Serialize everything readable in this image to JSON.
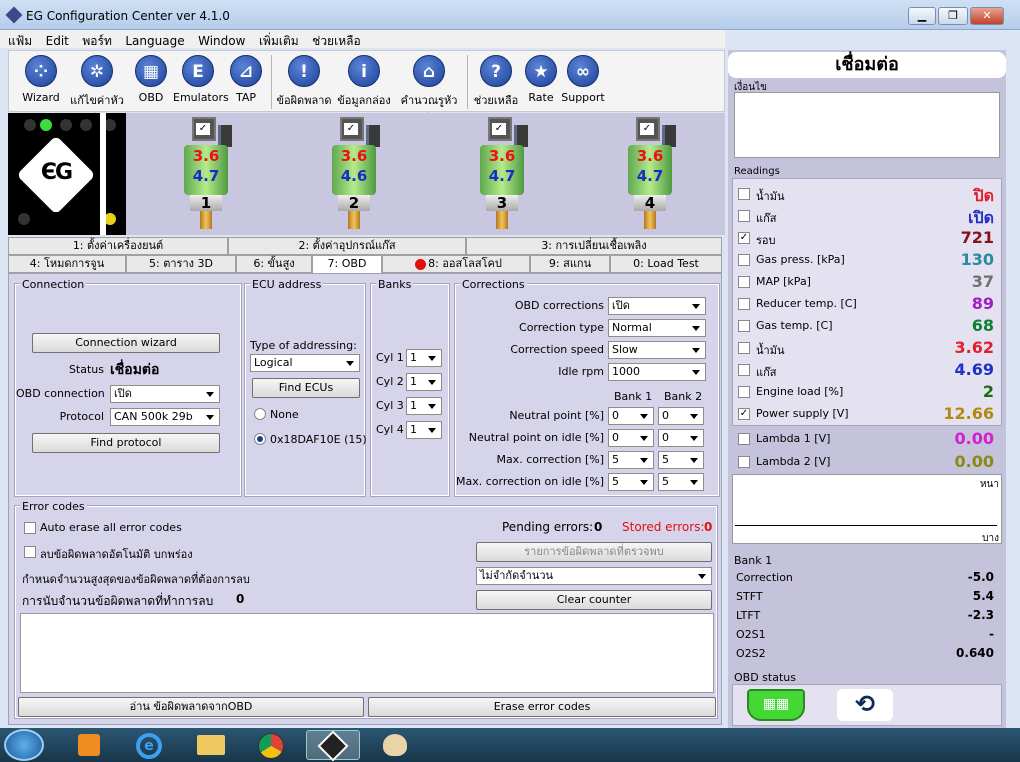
{
  "window": {
    "title": "EG Configuration Center ver 4.1.0"
  },
  "menu": [
    "แฟ้ม",
    "Edit",
    "พอร์ท",
    "Language",
    "Window",
    "เพิ่มเติม",
    "ช่วยเหลือ"
  ],
  "toolbar": [
    {
      "label": "Wizard",
      "icon": "wizard-icon",
      "glyph": "⁘"
    },
    {
      "label": "แก้ไขค่าหัวฉีด",
      "icon": "gear-icon",
      "glyph": "✲"
    },
    {
      "label": "OBD",
      "icon": "obd-icon",
      "glyph": "▦"
    },
    {
      "label": "Emulators",
      "icon": "emulator-icon",
      "glyph": "E"
    },
    {
      "label": "TAP",
      "icon": "tap-icon",
      "glyph": "⊿"
    },
    {
      "label": "ข้อผิดพลาด",
      "icon": "error-icon",
      "glyph": "!"
    },
    {
      "label": "ข้อมูลกล่อง",
      "icon": "info-icon",
      "glyph": "i"
    },
    {
      "label": "คำนวณรูหัวฉีด",
      "icon": "calc-icon",
      "glyph": "⌂"
    },
    {
      "label": "ช่วยเหลือ",
      "icon": "help-icon",
      "glyph": "?"
    },
    {
      "label": "Rate",
      "icon": "star-icon",
      "glyph": "★"
    },
    {
      "label": "Support",
      "icon": "support-icon",
      "glyph": "∞"
    }
  ],
  "injectors": [
    {
      "num": "1",
      "v1": "3.6",
      "v2": "4.7"
    },
    {
      "num": "2",
      "v1": "3.6",
      "v2": "4.6"
    },
    {
      "num": "3",
      "v1": "3.6",
      "v2": "4.7"
    },
    {
      "num": "4",
      "v1": "3.6",
      "v2": "4.7"
    }
  ],
  "tabs_row1": [
    "1: ตั้งค่าเครื่องยนต์",
    "2: ตั้งค่าอุปกรณ์แก๊ส",
    "3: การเปลี่ยนเชื้อเพลิง"
  ],
  "tabs_row2": [
    "4: โหมดการจูน",
    "5: ตาราง 3D",
    "6: ขั้นสูง",
    "7: OBD",
    "8: ออสโลสโคป",
    "9: สแกน",
    "0: Load Test"
  ],
  "connection": {
    "title": "Connection",
    "wizard_btn": "Connection wizard",
    "status_label": "Status",
    "status_value": "เชื่อมต่อ",
    "obd_label": "OBD connection",
    "obd_value": "เปิด",
    "protocol_label": "Protocol",
    "protocol_value": "CAN 500k 29b",
    "find_btn": "Find protocol"
  },
  "ecu": {
    "title": "ECU address",
    "type_label": "Type of addressing:",
    "type_value": "Logical",
    "find_btn": "Find ECUs",
    "opt_none": "None",
    "opt_addr": "0x18DAF10E (15)"
  },
  "banks": {
    "title": "Banks",
    "cyl": [
      {
        "label": "Cyl 1",
        "value": "1"
      },
      {
        "label": "Cyl 2",
        "value": "1"
      },
      {
        "label": "Cyl 3",
        "value": "1"
      },
      {
        "label": "Cyl 4",
        "value": "1"
      }
    ]
  },
  "corrections": {
    "title": "Corrections",
    "obd_corr_label": "OBD corrections",
    "obd_corr_value": "เปิด",
    "type_label": "Correction type",
    "type_value": "Normal",
    "speed_label": "Correction speed",
    "speed_value": "Slow",
    "idle_label": "Idle rpm",
    "idle_value": "1000",
    "bank1_hdr": "Bank 1",
    "bank2_hdr": "Bank 2",
    "rows": [
      {
        "label": "Neutral point [%]",
        "b1": "0",
        "b2": "0"
      },
      {
        "label": "Neutral point on idle [%]",
        "b1": "0",
        "b2": "0"
      },
      {
        "label": "Max. correction [%]",
        "b1": "5",
        "b2": "5"
      },
      {
        "label": "Max. correction on idle [%]",
        "b1": "5",
        "b2": "5"
      }
    ]
  },
  "errors": {
    "title": "Error codes",
    "auto_erase": "Auto erase all error codes",
    "auto_erase_th": "ลบข้อผิดพลาดอัตโนมัติ บกพร่อง",
    "pending_label": "Pending errors:",
    "pending_value": "0",
    "stored_label": "Stored errors:",
    "stored_value": "0",
    "list_btn": "รายการข้อผิดพลาดที่ตรวจพบ",
    "max_label": "กำหนดจำนวนสูงสุดของข้อผิดพลาดที่ต้องการลบ",
    "max_value": "ไม่จำกัดจำนวน",
    "counter_label": "การนับจำนวนข้อผิดพลาดที่ทำการลบ",
    "counter_value": "0",
    "clear_btn": "Clear counter",
    "read_btn": "อ่าน ข้อผิดพลาดจากOBD",
    "erase_btn": "Erase error codes"
  },
  "right": {
    "status_title": "เชื่อมต่อ",
    "cond_label": "เงื่อนไข",
    "readings_label": "Readings",
    "readings": [
      {
        "name": "น้ำมัน",
        "value": "ปิด",
        "color": "#e0202a",
        "checked": false
      },
      {
        "name": "แก๊ส",
        "value": "เปิด",
        "color": "#2030c8",
        "checked": false
      },
      {
        "name": "รอบ",
        "value": "721",
        "color": "#8a1020",
        "checked": true
      },
      {
        "name": "Gas press. [kPa]",
        "value": "130",
        "color": "#2a8aa0",
        "checked": false
      },
      {
        "name": "MAP [kPa]",
        "value": "37",
        "color": "#707070",
        "checked": false
      },
      {
        "name": "Reducer temp. [C]",
        "value": "89",
        "color": "#a020c0",
        "checked": false
      },
      {
        "name": "Gas temp. [C]",
        "value": "68",
        "color": "#108030",
        "checked": false
      },
      {
        "name": "น้ำมัน",
        "value": "3.62",
        "color": "#e0202a",
        "checked": false
      },
      {
        "name": "แก๊ส",
        "value": "4.69",
        "color": "#2030c8",
        "checked": false
      },
      {
        "name": "Engine load [%]",
        "value": "2",
        "color": "#1a6a10",
        "checked": false
      },
      {
        "name": "Power supply [V]",
        "value": "12.66",
        "color": "#b08a10",
        "checked": true
      }
    ],
    "lambda": [
      {
        "name": "Lambda 1 [V]",
        "value": "0.00",
        "color": "#d020d0"
      },
      {
        "name": "Lambda 2 [V]",
        "value": "0.00",
        "color": "#8a8a10"
      }
    ],
    "graph_top": "หนา",
    "graph_bottom": "บาง",
    "bank_title": "Bank 1",
    "bank": [
      {
        "name": "Correction",
        "value": "-5.0"
      },
      {
        "name": "STFT",
        "value": "5.4"
      },
      {
        "name": "LTFT",
        "value": "-2.3"
      },
      {
        "name": "O2S1",
        "value": "-"
      },
      {
        "name": "O2S2",
        "value": "0.640"
      }
    ],
    "obd_status": "OBD status"
  }
}
